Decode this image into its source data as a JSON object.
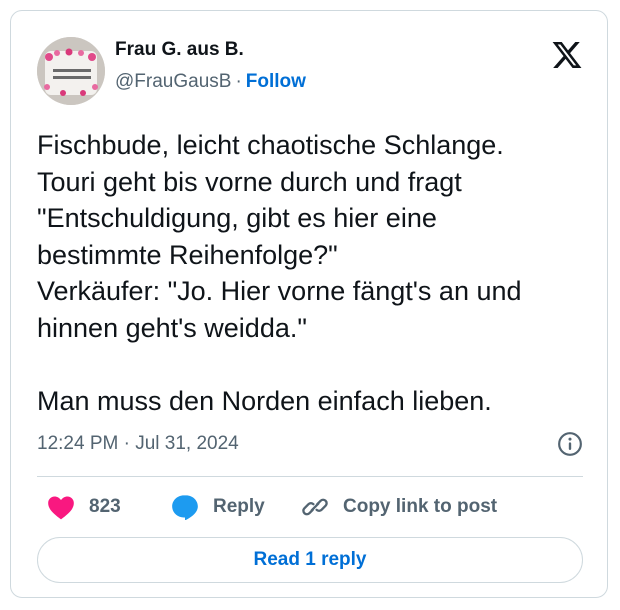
{
  "author": {
    "display_name": "Frau G. aus B.",
    "handle": "@FrauGausB",
    "separator": "·",
    "follow_label": "Follow",
    "avatar_text": "ICH BIN NUR ZUM NÖRGELN HIER"
  },
  "tweet": {
    "lines": [
      "Fischbude, leicht chaotische Schlange.",
      "Touri geht bis vorne durch und fragt",
      "\"Entschuldigung, gibt es hier eine",
      "bestimmte Reihenfolge?\"",
      "Verkäufer: \"Jo. Hier vorne fängt's an und",
      "hinnen geht's weidda.\"",
      "",
      "Man muss den Norden einfach lieben."
    ],
    "timestamp": "12:24 PM · Jul 31, 2024"
  },
  "actions": {
    "like_count": "823",
    "reply_label": "Reply",
    "copy_label": "Copy link to post"
  },
  "footer": {
    "read_replies_label": "Read 1 reply"
  },
  "colors": {
    "like": "#f91880",
    "reply": "#1d9bf0",
    "link": "#006fd6",
    "muted": "#536471",
    "border": "#cfd9de"
  },
  "icons": {
    "brand": "x-logo-icon",
    "info": "info-icon",
    "like": "heart-icon",
    "reply": "speech-bubble-icon",
    "copy": "link-icon"
  }
}
